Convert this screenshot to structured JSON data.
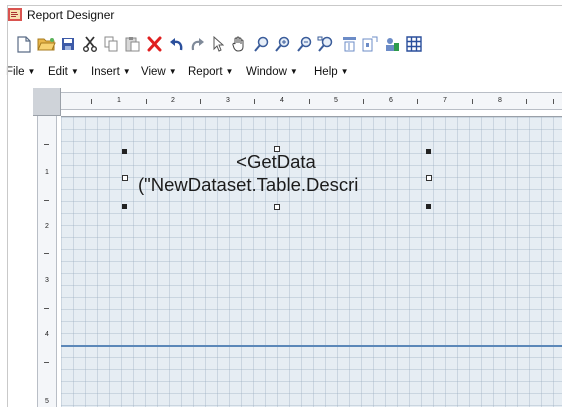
{
  "window": {
    "title": "Report Designer"
  },
  "toolbar": {
    "buttons": [
      {
        "name": "new-icon"
      },
      {
        "name": "open-folder-icon"
      },
      {
        "name": "save-icon"
      },
      {
        "name": "cut-icon"
      },
      {
        "name": "copy-icon"
      },
      {
        "name": "paste-icon"
      },
      {
        "name": "delete-icon"
      },
      {
        "name": "undo-icon"
      },
      {
        "name": "redo-icon"
      },
      {
        "name": "pointer-icon"
      },
      {
        "name": "pan-hand-icon"
      },
      {
        "name": "zoom-icon"
      },
      {
        "name": "zoom-in-icon"
      },
      {
        "name": "zoom-out-icon"
      },
      {
        "name": "zoom-fit-icon"
      },
      {
        "name": "align-icon"
      },
      {
        "name": "size-icon"
      },
      {
        "name": "properties-icon"
      },
      {
        "name": "grid-icon"
      }
    ]
  },
  "menu": {
    "items": [
      {
        "label": "File"
      },
      {
        "label": "Edit"
      },
      {
        "label": "Insert"
      },
      {
        "label": "View"
      },
      {
        "label": "Report"
      },
      {
        "label": "Window"
      },
      {
        "label": "Help"
      }
    ],
    "caret": "▼"
  },
  "ruler": {
    "horizontal": [
      "1",
      "2",
      "3",
      "4",
      "5",
      "6",
      "7",
      "8"
    ],
    "vertical": [
      "1",
      "2",
      "3",
      "4",
      "5"
    ]
  },
  "textbox": {
    "line1": "<GetData",
    "line2": "(\"NewDataset.Table.Descri"
  },
  "colors": {
    "canvas": "#e6edf3",
    "band_line": "#5b87b8"
  }
}
